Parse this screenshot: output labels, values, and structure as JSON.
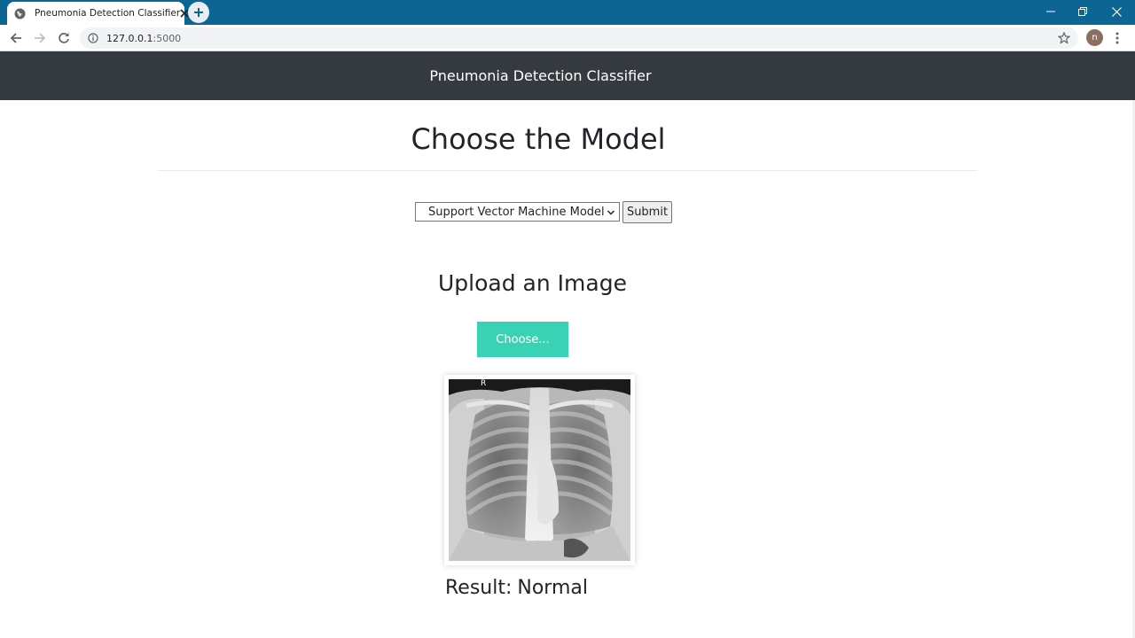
{
  "browser": {
    "tab_title": "Pneumonia Detection Classifier",
    "url_host": "127.0.0.1",
    "url_port": ":5000",
    "profile_initial": "n",
    "icons": [
      "globe-icon",
      "close-icon",
      "plus-icon",
      "minimize-icon",
      "restore-icon",
      "window-close-icon",
      "back-arrow-icon",
      "forward-arrow-icon",
      "reload-icon",
      "info-icon",
      "star-icon",
      "kebab-menu-icon"
    ]
  },
  "navbar": {
    "brand": "Pneumonia Detection Classifier"
  },
  "model_section": {
    "heading": "Choose the Model",
    "selected_model": "Support Vector Machine Model",
    "submit_label": "Submit"
  },
  "upload_section": {
    "heading": "Upload an Image",
    "choose_label": "Choose...",
    "image_marker": "R"
  },
  "result": {
    "label": "Result:",
    "value": "Normal"
  },
  "colors": {
    "titlebar": "#0c6593",
    "navbar": "#343a40",
    "choose_button": "#39d2b4",
    "text": "#212529"
  }
}
